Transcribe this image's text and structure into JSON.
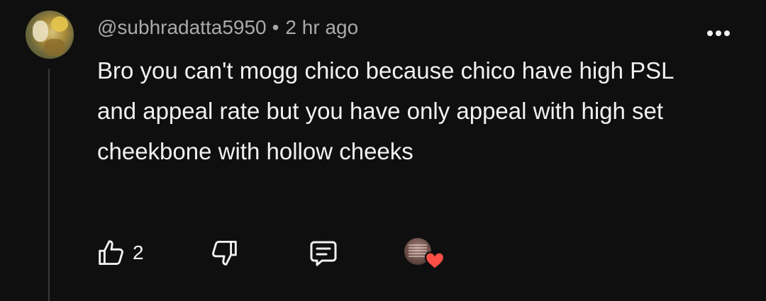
{
  "comment": {
    "author": "@subhradatta5950",
    "separator": "•",
    "time": "2 hr ago",
    "text": "Bro you can't mogg chico because chico have high PSL and appeal rate but you have only appeal with high set cheekbone with hollow cheeks",
    "like_count": "2"
  },
  "icons": {
    "like": "thumbs-up-icon",
    "dislike": "thumbs-down-icon",
    "reply": "comment-reply-icon",
    "menu": "more-vertical-dots-icon",
    "creator_heart": "heart-icon"
  },
  "colors": {
    "background": "#0f0f0f",
    "text": "#f1f1f1",
    "secondary_text": "#aaaaaa",
    "heart": "#ff4e45"
  }
}
